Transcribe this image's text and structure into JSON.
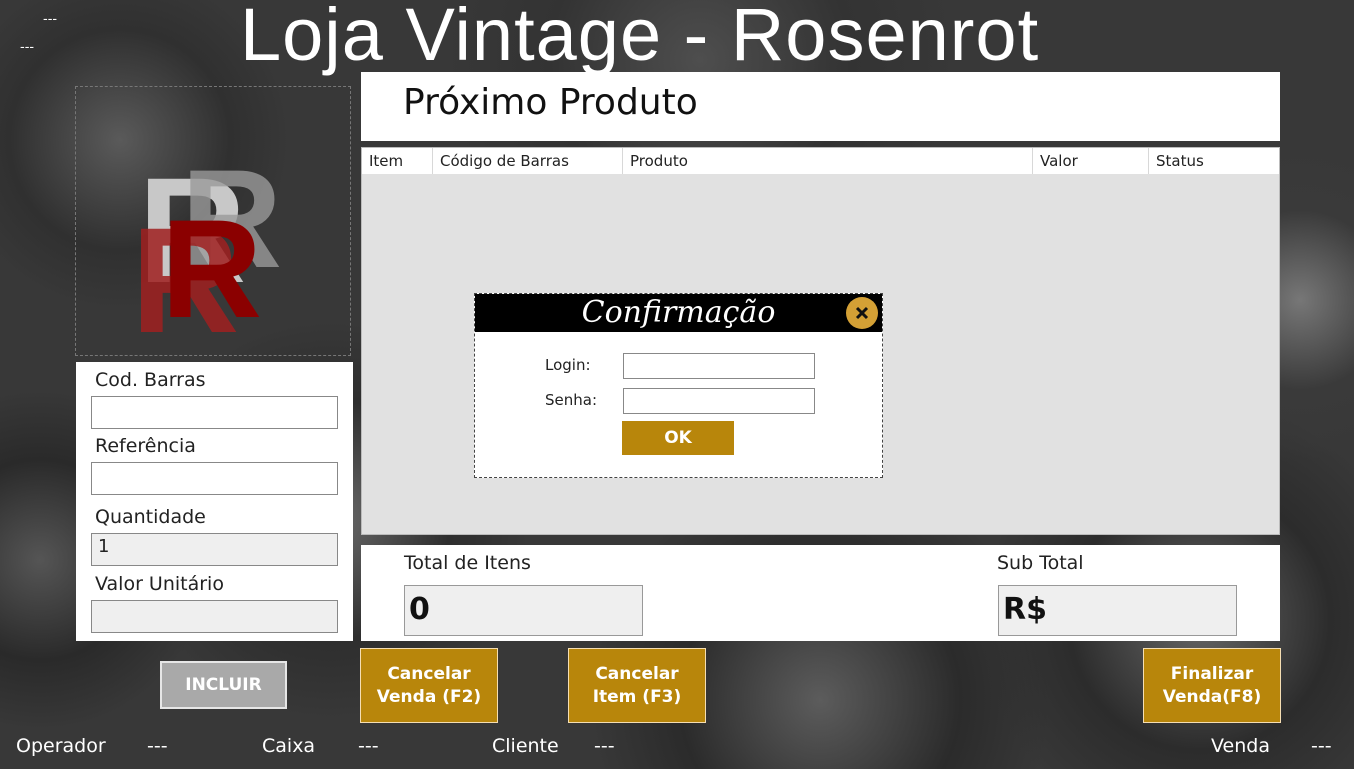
{
  "header": {
    "title": "Loja Vintage - Rosenrot",
    "corner_top": "---",
    "corner_bottom": "---"
  },
  "colors": {
    "accent": "#b8860b",
    "logo_red": "#8b0000",
    "dialog_header": "#000000"
  },
  "next_product": {
    "title": "Próximo Produto"
  },
  "grid": {
    "columns": [
      "Item",
      "Código de Barras",
      "Produto",
      "Valor",
      "Status"
    ],
    "rows": []
  },
  "form": {
    "barcode_label": "Cod. Barras",
    "barcode_value": "",
    "reference_label": "Referência",
    "reference_value": "",
    "quantity_label": "Quantidade",
    "quantity_value": "1",
    "unit_value_label": "Valor Unitário",
    "unit_value_value": "",
    "include_button": "INCLUIR"
  },
  "totals": {
    "items_label": "Total de Itens",
    "items_value": "0",
    "subtotal_label": "Sub Total",
    "subtotal_value": "R$"
  },
  "actions": {
    "cancel_sale": "Cancelar Venda (F2)",
    "cancel_item": "Cancelar Item (F3)",
    "finalize_sale": "Finalizar Venda(F8)"
  },
  "status_bar": {
    "operator_label": "Operador",
    "operator_value": "---",
    "register_label": "Caixa",
    "register_value": "---",
    "customer_label": "Cliente",
    "customer_value": "---",
    "sale_label": "Venda",
    "sale_value": "---"
  },
  "dialog": {
    "title": "Confirmação",
    "close_icon": "close-icon",
    "login_label": "Login:",
    "login_value": "",
    "password_label": "Senha:",
    "password_value": "",
    "ok_button": "OK"
  }
}
